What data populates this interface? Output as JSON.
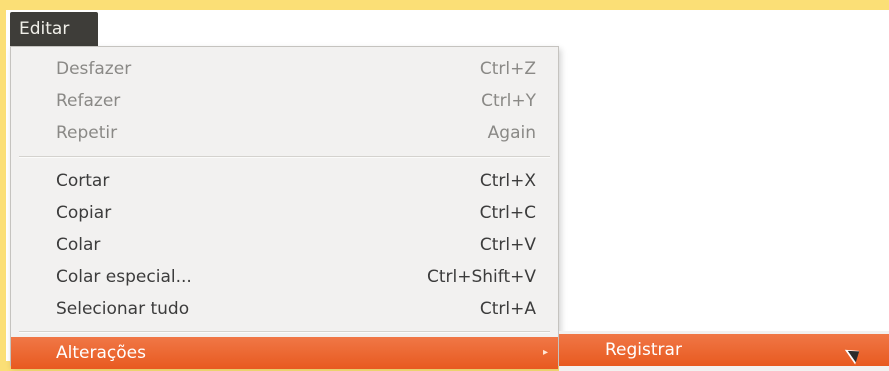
{
  "menubar": {
    "label": "Editar"
  },
  "menu": {
    "items": [
      {
        "label": "Desfazer",
        "accel": "Ctrl+Z"
      },
      {
        "label": "Refazer",
        "accel": "Ctrl+Y"
      },
      {
        "label": "Repetir",
        "accel": "Again"
      },
      {
        "label": "Cortar",
        "accel": "Ctrl+X"
      },
      {
        "label": "Copiar",
        "accel": "Ctrl+C"
      },
      {
        "label": "Colar",
        "accel": "Ctrl+V"
      },
      {
        "label": "Colar especial...",
        "accel": "Ctrl+Shift+V"
      },
      {
        "label": "Selecionar tudo",
        "accel": "Ctrl+A"
      },
      {
        "label": "Alterações",
        "accel": ""
      }
    ]
  },
  "submenu": {
    "items": [
      {
        "label": "Registrar"
      }
    ]
  },
  "colors": {
    "highlight": "#e85a20",
    "menu_bg": "#f2f1f0",
    "menubar_bg": "#3e3d39",
    "frame": "#fbdf76"
  },
  "icons": {
    "submenu_arrow": "triangle-right",
    "cursor": "mouse-pointer"
  }
}
